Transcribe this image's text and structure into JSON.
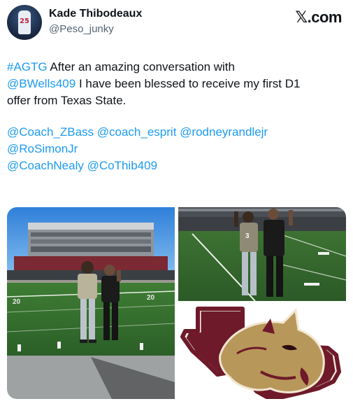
{
  "author": {
    "name": "Kade Thibodeaux",
    "handle": "@Peso_junky",
    "avatar_number": "25"
  },
  "brand": {
    "x_glyph": "𝕏",
    "domain": ".com"
  },
  "tweet": {
    "line1_hashtag": "#AGTG",
    "line1_text": " After an amazing conversation with",
    "line2_mention": "@BWells409",
    "line2_text": " I have been blessed to receive my first D1",
    "line3_text": "offer from Texas State.",
    "mentions_row1": [
      "@Coach_ZBass",
      "@coach_esprit",
      "@rodneyrandlejr"
    ],
    "mentions_row2": [
      "@RoSimonJr"
    ],
    "mentions_row3": [
      "@CoachNealy",
      "@CoThib409"
    ]
  },
  "media": {
    "photo1_icon": "stadium-photo-icon",
    "photo2_icon": "field-photo-icon",
    "logo_icon": "texas-state-bobcat-logo-icon",
    "jersey_number": "3"
  },
  "colors": {
    "link": "#1d9bf0",
    "text": "#0f1419",
    "secondary": "#536471",
    "maroon": "#6e1a2a",
    "gold": "#b8975a"
  }
}
